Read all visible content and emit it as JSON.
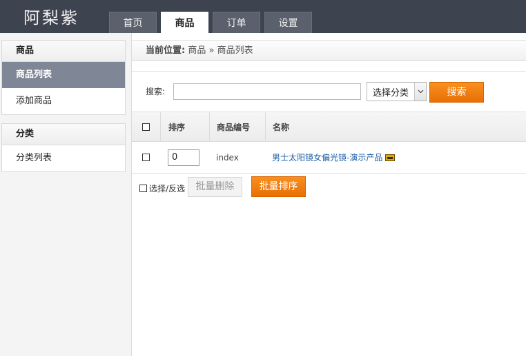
{
  "header": {
    "logo": "阿梨紫",
    "tabs": [
      {
        "label": "首页",
        "active": false
      },
      {
        "label": "商品",
        "active": true
      },
      {
        "label": "订单",
        "active": false
      },
      {
        "label": "设置",
        "active": false
      }
    ]
  },
  "sidebar": {
    "groups": [
      {
        "title": "商品",
        "items": [
          {
            "label": "商品列表",
            "active": true
          },
          {
            "label": "添加商品",
            "active": false
          }
        ]
      },
      {
        "title": "分类",
        "items": [
          {
            "label": "分类列表",
            "active": false
          }
        ]
      }
    ]
  },
  "breadcrumb": {
    "label": "当前位置:",
    "path": [
      "商品",
      "商品列表"
    ],
    "separator": "»"
  },
  "search": {
    "label": "搜索:",
    "value": "",
    "category_select": "选择分类",
    "button": "搜索"
  },
  "table": {
    "headers": [
      "排序",
      "商品编号",
      "名称"
    ],
    "rows": [
      {
        "checked": false,
        "sort": "0",
        "code": "index",
        "name": "男士太阳镜女偏光镜-演示产品",
        "has_image": true
      }
    ]
  },
  "actions": {
    "select_all": "选择/反选",
    "batch_delete": "批量删除",
    "batch_sort": "批量排序"
  },
  "colors": {
    "header_bg": "#3e4350",
    "accent_orange": "#f28a1a",
    "sidebar_active": "#7f8796",
    "link": "#1f5fa6"
  }
}
